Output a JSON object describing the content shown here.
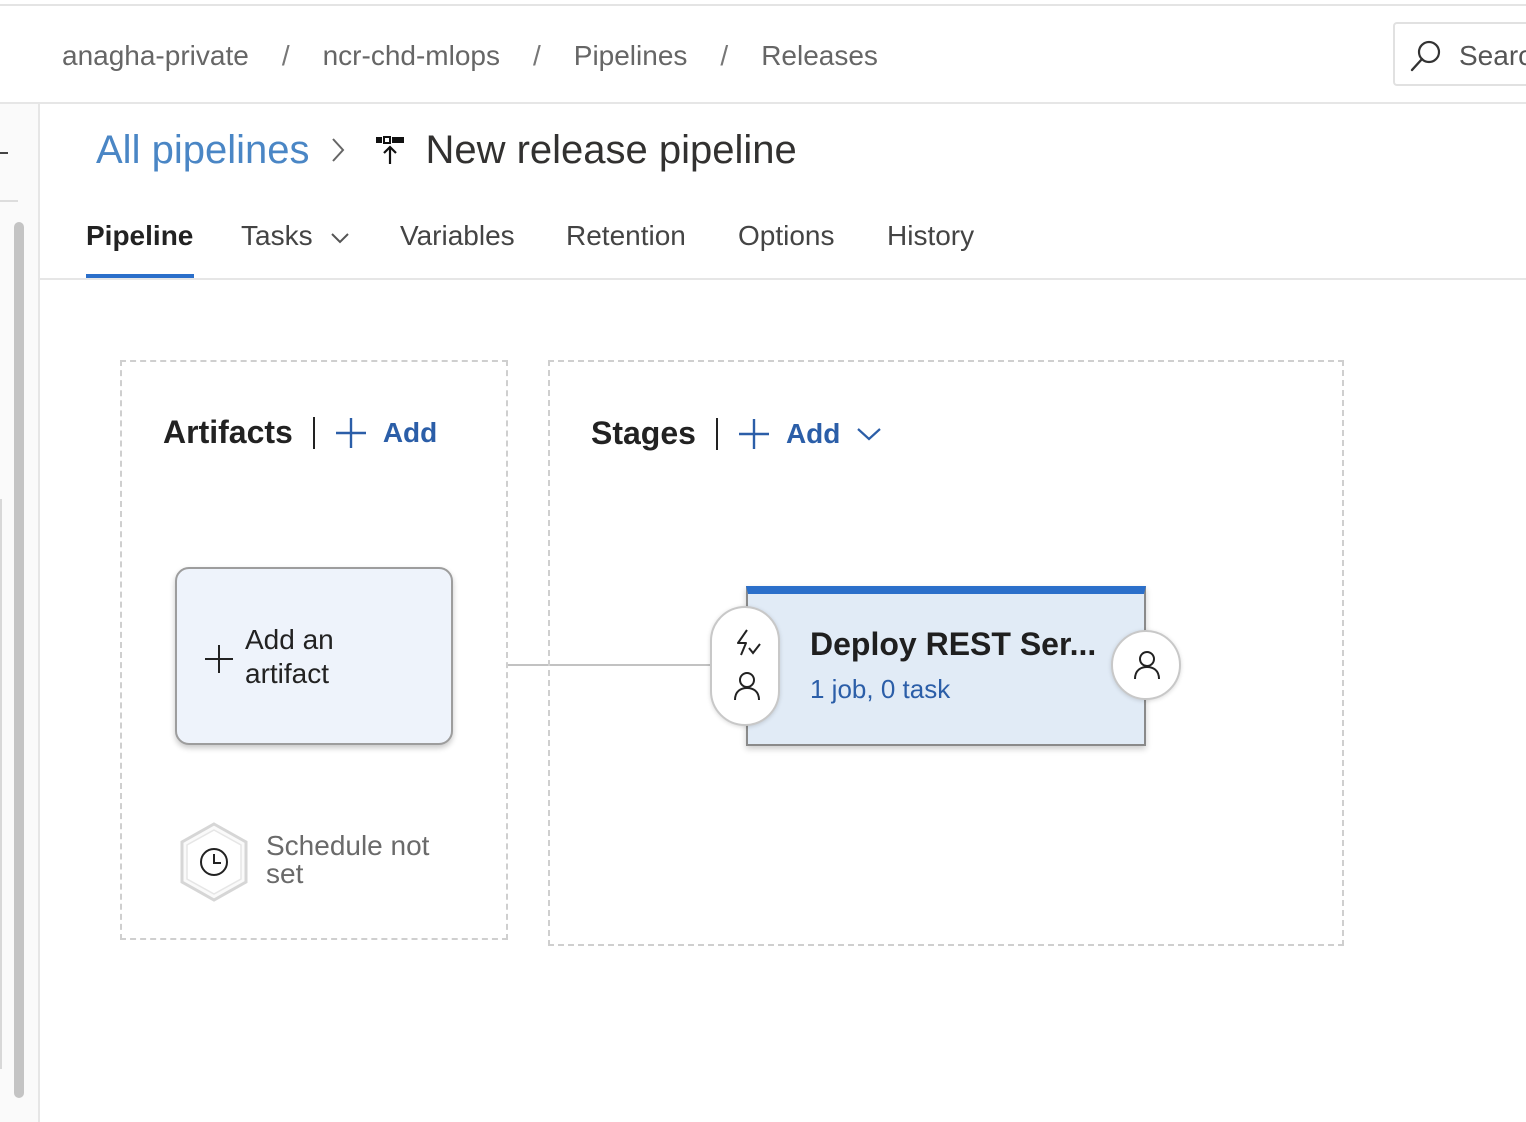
{
  "breadcrumb": {
    "items": [
      "anagha-private",
      "ncr-chd-mlops",
      "Pipelines",
      "Releases"
    ],
    "separator": "/"
  },
  "search": {
    "placeholder": "Search"
  },
  "title_row": {
    "all_pipelines": "All pipelines",
    "title": "New release pipeline"
  },
  "tabs": [
    "Pipeline",
    "Tasks",
    "Variables",
    "Retention",
    "Options",
    "History"
  ],
  "active_tab": "Pipeline",
  "artifacts": {
    "heading": "Artifacts",
    "add_label": "Add",
    "add_artifact_label": "Add an artifact",
    "schedule_text": "Schedule not set"
  },
  "stages": {
    "heading": "Stages",
    "add_label": "Add",
    "items": [
      {
        "name": "Deploy REST Ser...",
        "summary": "1 job, 0 task"
      }
    ]
  },
  "colors": {
    "accent": "#2b6fca",
    "link": "#2b5ea8",
    "stage_bg": "#e1ebf6",
    "artifact_bg": "#eef3fb"
  },
  "icons": {
    "search": "search-icon",
    "breadcrumb_chevron": "chevron-right-icon",
    "pipeline": "release-pipeline-icon",
    "tasks_dropdown": "chevron-down-icon",
    "add": "plus-icon",
    "schedule": "clock-icon",
    "pre_deployment_trigger": "lightning-icon",
    "approver": "person-icon"
  }
}
